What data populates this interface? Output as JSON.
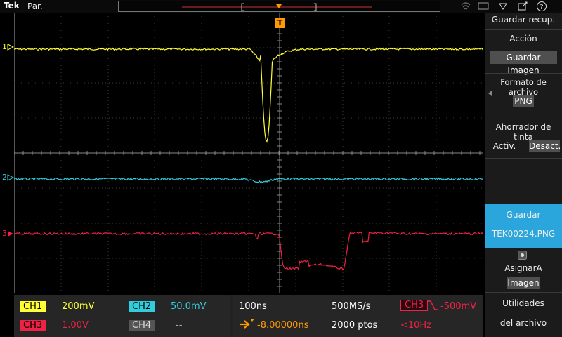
{
  "header": {
    "brand": "Tek",
    "run_state": "Par."
  },
  "trigger_marker": "T",
  "channels_markers": {
    "ch1": "1",
    "ch2": "2",
    "ch3": "3"
  },
  "colors": {
    "ch1": "#ffff33",
    "ch2": "#33ccdd",
    "ch3": "#ee2244",
    "accent": "#ff9900",
    "selected": "#2aa6dc"
  },
  "status": {
    "ch1_label": "CH1",
    "ch1_scale": "200mV",
    "ch2_label": "CH2",
    "ch2_scale": "50.0mV",
    "ch3_label": "CH3",
    "ch3_scale": "1.00V",
    "ch4_label": "CH4",
    "ch4_scale": "--",
    "timebase": "100ns",
    "sample_rate": "500MS/s",
    "delay": "-8.00000ns",
    "record_length": "2000 ptos",
    "trigger_source": "CH3",
    "trigger_level": "-500mV",
    "trigger_freq": "<10Hz"
  },
  "side_menu": {
    "title": "Guardar recup.",
    "action_label": "Acción",
    "action_value": "Guardar Imagen",
    "format_label": "Formato de archivo",
    "format_value": "PNG",
    "ink_label": "Ahorrador de tinta",
    "ink_on": "Activ.",
    "ink_off": "Desact.",
    "save_label": "Guardar",
    "save_filename": "TEK00224.PNG",
    "assign_label": "AsignarA",
    "assign_value": "Imagen",
    "utilities_line1": "Utilidades",
    "utilities_line2": "del archivo"
  }
}
